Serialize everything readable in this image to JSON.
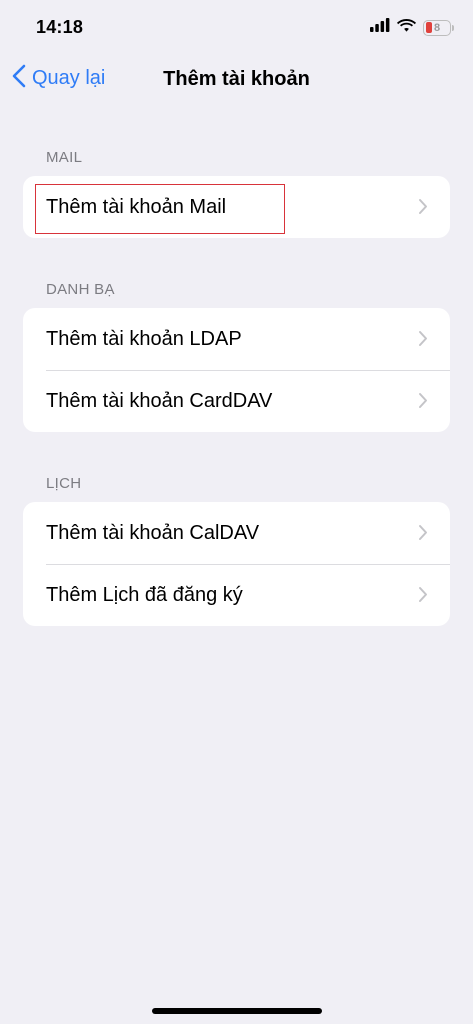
{
  "status_bar": {
    "time": "14:18",
    "battery_level": "8",
    "icons": [
      "cellular-signal-icon",
      "wifi-icon",
      "battery-icon"
    ]
  },
  "nav": {
    "back_label": "Quay lại",
    "title": "Thêm tài khoản"
  },
  "sections": [
    {
      "header": "MAIL",
      "items": [
        {
          "label": "Thêm tài khoản Mail",
          "highlighted": true
        }
      ]
    },
    {
      "header": "DANH BẠ",
      "items": [
        {
          "label": "Thêm tài khoản LDAP"
        },
        {
          "label": "Thêm tài khoản CardDAV"
        }
      ]
    },
    {
      "header": "LỊCH",
      "items": [
        {
          "label": "Thêm tài khoản CalDAV"
        },
        {
          "label": "Thêm Lịch đã đăng ký"
        }
      ]
    }
  ],
  "colors": {
    "background": "#f0eff5",
    "accent": "#2f7cf6",
    "highlight": "#d8333a",
    "battery_low": "#e0413c"
  }
}
